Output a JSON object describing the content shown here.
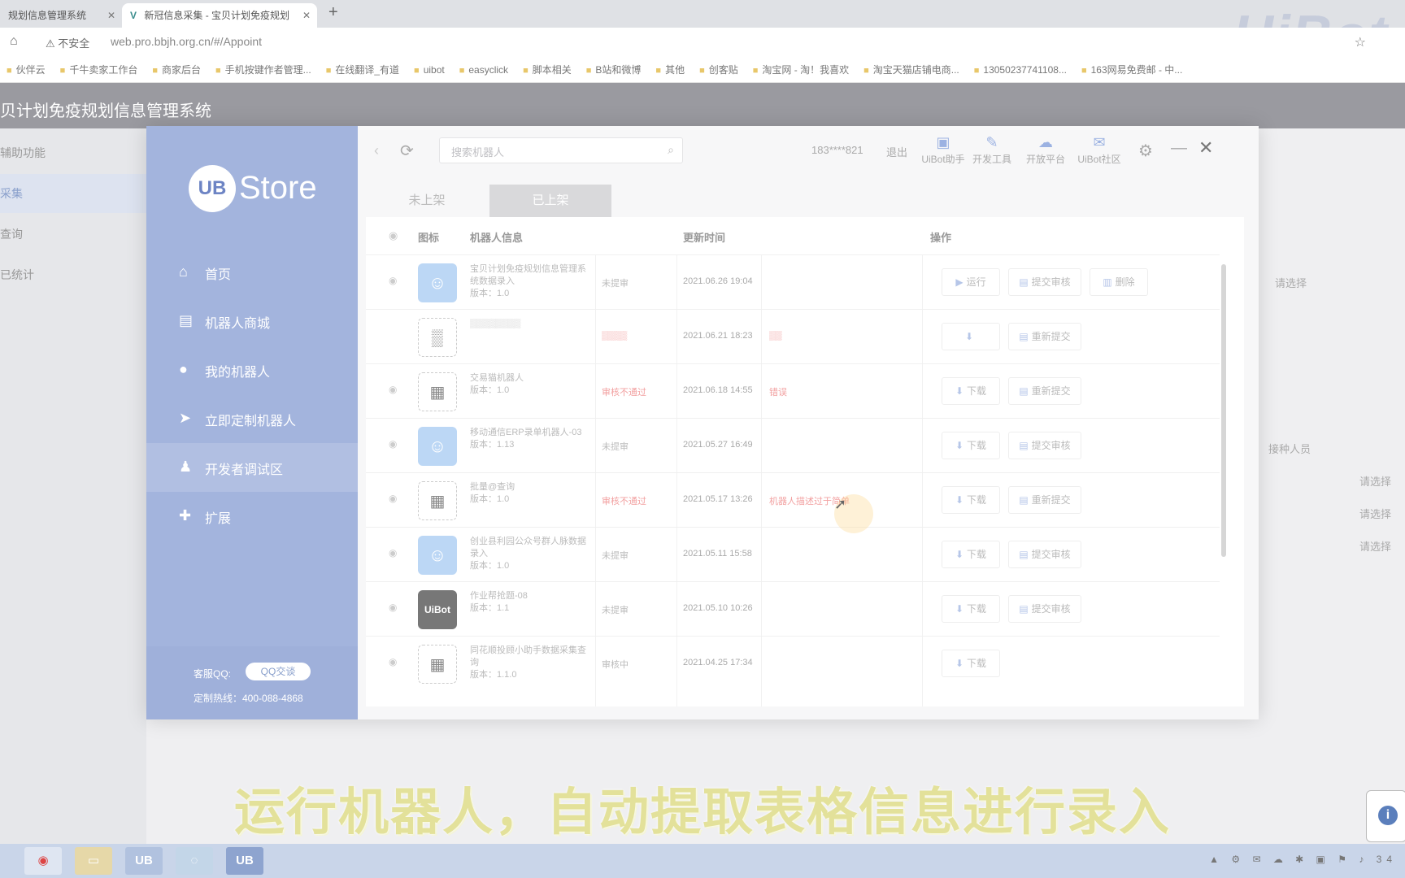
{
  "browser": {
    "tabs": [
      {
        "label": "规划信息管理系统"
      },
      {
        "label": "新冠信息采集 - 宝贝计划免疫规划"
      }
    ],
    "insecure": "不安全",
    "url": "web.pro.bbjh.org.cn/#/Appoint",
    "bookmarks": [
      "伙伴云",
      "千牛卖家工作台",
      "商家后台",
      "手机按键作者管理...",
      "在线翻译_有道",
      "uibot",
      "easyclick",
      "脚本相关",
      "B站和微博",
      "其他",
      "创客贴",
      "淘宝网 - 淘！我喜欢",
      "淘宝天猫店铺电商...",
      "13050237741108...",
      "163网易免费邮 - 中..."
    ],
    "logo_text": "UiBot"
  },
  "app": {
    "title": "贝计划免疫规划信息管理系统",
    "side_items": [
      "辅助功能",
      "采集",
      "查询",
      "已统计"
    ],
    "right_labels": {
      "select1": "请选择",
      "vaccinator": "接种人员",
      "select2": "请选择",
      "select3": "请选择",
      "select4": "请选择"
    }
  },
  "store": {
    "logo_circle": "UB",
    "logo_text": "Store",
    "nav": [
      {
        "label": "首页",
        "icon": "home-icon"
      },
      {
        "label": "机器人商城",
        "icon": "store-icon"
      },
      {
        "label": "我的机器人",
        "icon": "robot-icon"
      },
      {
        "label": "立即定制机器人",
        "icon": "send-icon"
      },
      {
        "label": "开发者调试区",
        "icon": "developer-icon"
      },
      {
        "label": "扩展",
        "icon": "puzzle-icon"
      }
    ],
    "qq_label": "客服QQ:",
    "qq_button": "QQ交谈",
    "hotline": "定制热线：400-088-4868",
    "search_placeholder": "搜索机器人",
    "account": "183****821",
    "logout": "退出",
    "tools": [
      "UiBot助手",
      "开发工具",
      "开放平台",
      "UiBot社区"
    ],
    "tabs": {
      "off": "未上架",
      "on": "已上架"
    },
    "headers": {
      "icon": "图标",
      "info": "机器人信息",
      "updated": "更新时间",
      "ops": "操作"
    },
    "rows": [
      {
        "name": "宝贝计划免疫规划信息管理系统数据录入",
        "version": "版本：1.0",
        "status": "未提审",
        "date": "2021.06.26 19:04",
        "remark": "",
        "icon": "blue",
        "actions": [
          "运行",
          "提交审核",
          "删除"
        ]
      },
      {
        "name": "",
        "version": "",
        "status": "",
        "date": "2021.06.21 18:23",
        "remark": "",
        "icon": "blur",
        "actions": [
          "",
          "重新提交"
        ]
      },
      {
        "name": "交易猫机器人",
        "version": "版本：1.0",
        "status": "审核不通过",
        "date": "2021.06.18 14:55",
        "remark": "错误",
        "icon": "qr",
        "actions": [
          "下载",
          "重新提交"
        ]
      },
      {
        "name": "移动通信ERP录单机器人-03",
        "version": "版本：1.13",
        "status": "未提审",
        "date": "2021.05.27 16:49",
        "remark": "",
        "icon": "blue",
        "actions": [
          "下载",
          "提交审核"
        ]
      },
      {
        "name": "批量@查询",
        "version": "版本：1.0",
        "status": "审核不通过",
        "date": "2021.05.17 13:26",
        "remark": "机器人描述过于简单",
        "icon": "qr",
        "actions": [
          "下载",
          "重新提交"
        ]
      },
      {
        "name": "创业县利园公众号群人脉数据录入",
        "version": "版本：1.0",
        "status": "未提审",
        "date": "2021.05.11 15:58",
        "remark": "",
        "icon": "blue",
        "actions": [
          "下载",
          "提交审核"
        ]
      },
      {
        "name": "作业帮抢题-08",
        "version": "版本：1.1",
        "status": "未提审",
        "date": "2021.05.10 10:26",
        "remark": "",
        "icon": "dark",
        "actions": [
          "下载",
          "提交审核"
        ]
      },
      {
        "name": "同花顺投顾小助手数据采集查询",
        "version": "版本：1.1.0",
        "status": "审核中",
        "date": "2021.04.25 17:34",
        "remark": "",
        "icon": "qr",
        "actions": [
          "下载"
        ]
      }
    ]
  },
  "caption": "运行机器人，自动提取表格信息进行录入",
  "colors": {
    "store_sidebar": "#a3b4dd",
    "caption": "#e3e19a",
    "status_red": "#f2a0a0"
  }
}
